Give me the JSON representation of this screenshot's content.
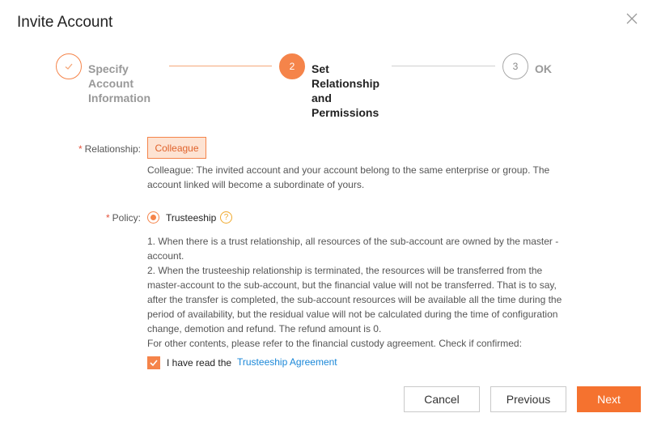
{
  "dialog": {
    "title": "Invite Account"
  },
  "steps": [
    {
      "label_lines": [
        "Specify",
        "Account",
        "Information"
      ],
      "status": "done",
      "number": ""
    },
    {
      "label_lines": [
        "Set",
        "Relationship",
        "and",
        "Permissions"
      ],
      "status": "active",
      "number": "2"
    },
    {
      "label_lines": [
        "OK"
      ],
      "status": "pending",
      "number": "3"
    }
  ],
  "form": {
    "relationship": {
      "required_mark": "*",
      "label": "Relationship:",
      "value": "Colleague",
      "description_lines": [
        "Colleague: The invited account and your account belong to the same enterprise or group. The",
        "account linked will become a subordinate of yours."
      ]
    },
    "policy": {
      "required_mark": "*",
      "label": "Policy:",
      "option": "Trusteeship",
      "selected": true,
      "help_icon": "question-icon",
      "text_lines": [
        "1. When there is a trust relationship, all resources of the sub-account are owned by the master -",
        "account.",
        "2. When the trusteeship relationship is terminated, the resources will be transferred from the",
        "master-account to the sub-account, but the financial value will not be transferred. That is to say,",
        "after the transfer is completed, the sub-account resources will be available all the time during the",
        "period of availability, but the residual value will not be calculated during the time of configuration",
        "change, demotion and refund. The refund amount is 0.",
        "For other contents, please refer to the financial custody agreement. Check if confirmed:"
      ]
    },
    "agreement": {
      "checked": true,
      "label": "I have read the",
      "link_text": "Trusteeship Agreement"
    }
  },
  "buttons": {
    "cancel": "Cancel",
    "previous": "Previous",
    "next": "Next"
  },
  "colors": {
    "accent": "#f5722f",
    "link": "#1a87d8",
    "required": "#e5533c",
    "help": "#f0a92c"
  }
}
